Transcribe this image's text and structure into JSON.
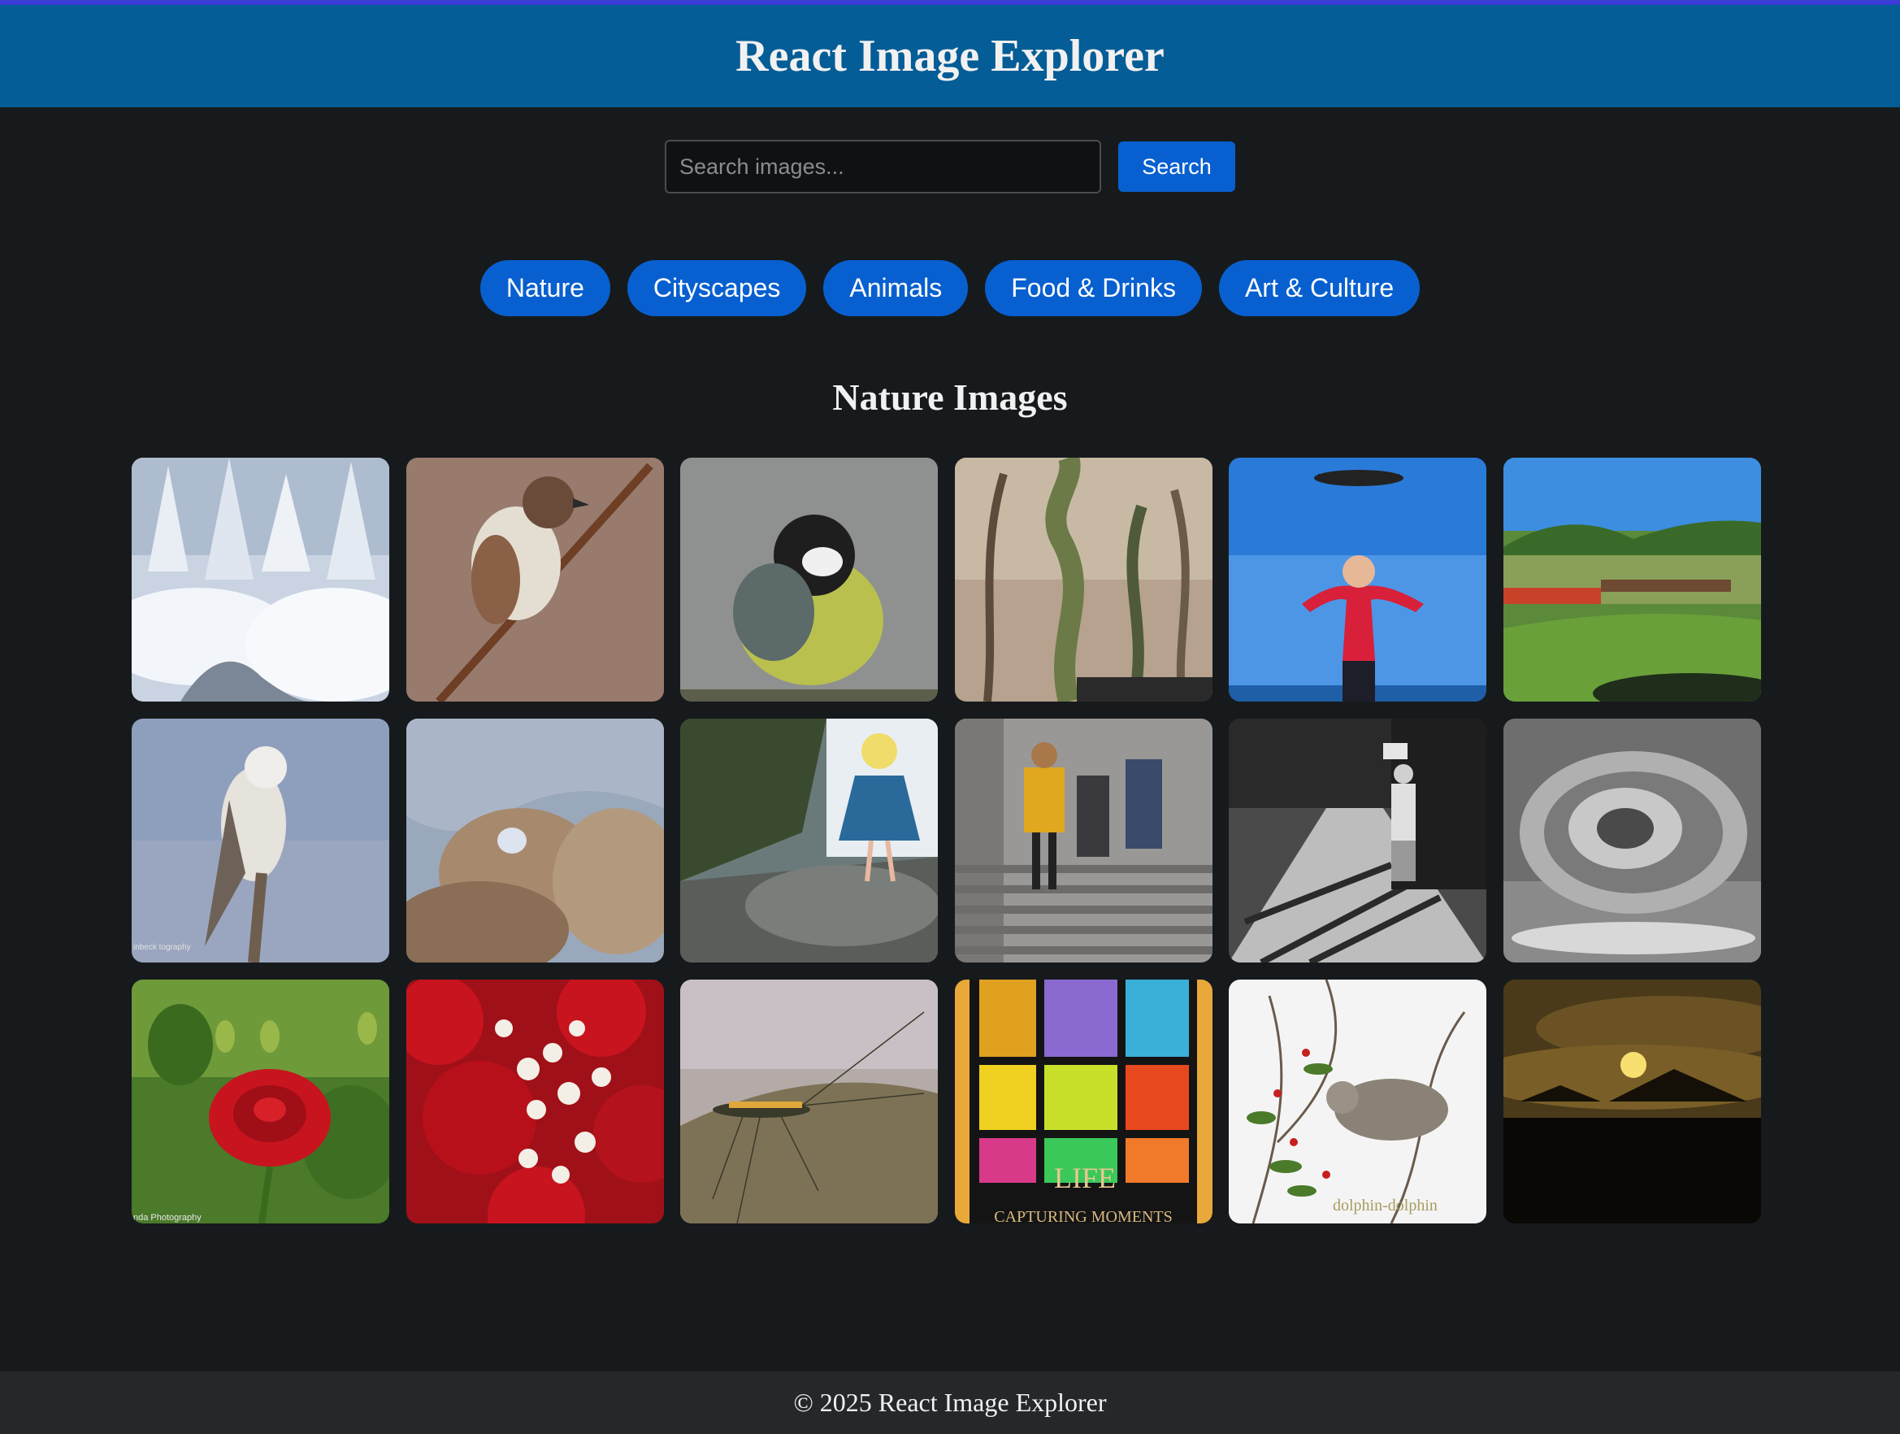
{
  "header": {
    "title": "React Image Explorer"
  },
  "search": {
    "placeholder": "Search images...",
    "value": "",
    "button_label": "Search"
  },
  "categories": [
    {
      "label": "Nature"
    },
    {
      "label": "Cityscapes"
    },
    {
      "label": "Animals"
    },
    {
      "label": "Food & Drinks"
    },
    {
      "label": "Art & Culture"
    }
  ],
  "gallery": {
    "title": "Nature Images",
    "images": [
      {
        "subject": "snowy forest"
      },
      {
        "subject": "sparrow on branch"
      },
      {
        "subject": "great tit bird"
      },
      {
        "subject": "twisted trees"
      },
      {
        "subject": "girl jumping under airplane"
      },
      {
        "subject": "train through countryside"
      },
      {
        "subject": "kite bird on branch",
        "watermark": "inbeck\ntography"
      },
      {
        "subject": "rock arch in desert"
      },
      {
        "subject": "woman on cliff"
      },
      {
        "subject": "people on stairs"
      },
      {
        "subject": "black and white street"
      },
      {
        "subject": "black and white dahlia"
      },
      {
        "subject": "red rose",
        "watermark": "nda Photography"
      },
      {
        "subject": "roses and baby's breath"
      },
      {
        "subject": "insect on rock"
      },
      {
        "subject": "stained glass art",
        "caption_1": "LIFE",
        "caption_2": "CAPTURING MOMENTS"
      },
      {
        "subject": "bird in mistletoe",
        "watermark": "dolphin-dolphin"
      },
      {
        "subject": "sunset silhouette"
      }
    ]
  },
  "footer": {
    "text": "© 2025 React Image Explorer"
  },
  "colors": {
    "header_bg": "#045d96",
    "page_bg": "#171a1c",
    "accent": "#0860d0",
    "footer_bg": "#25282b"
  }
}
